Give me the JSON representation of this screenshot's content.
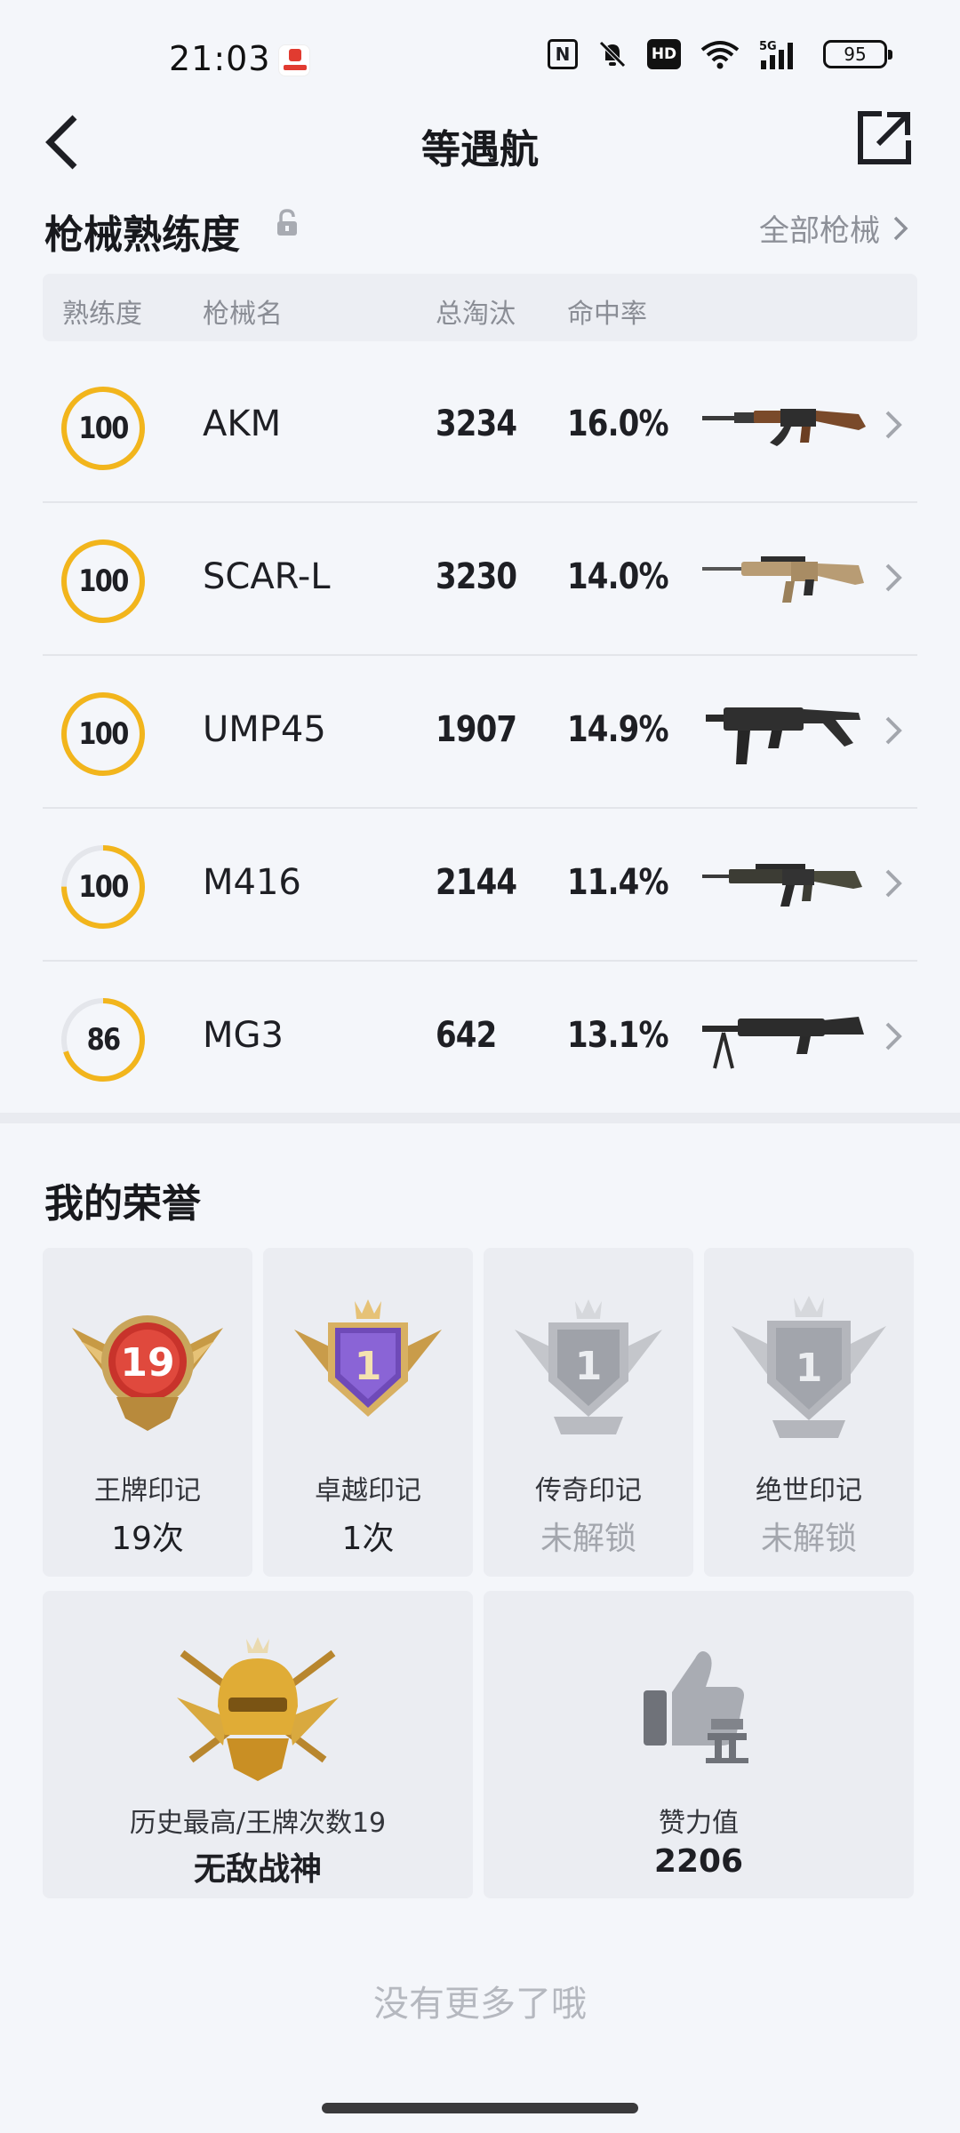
{
  "status_bar": {
    "time": "21:03",
    "icons": [
      "app-notification-icon",
      "nfc-icon",
      "mute-icon",
      "hd-icon",
      "wifi-icon",
      "5g-signal-icon"
    ],
    "nfc_text": "N",
    "hd_text": "HD",
    "net_text": "5G",
    "battery": "95"
  },
  "header": {
    "title": "等遇航",
    "back_icon": "chevron-left-icon",
    "share_icon": "share-external-icon"
  },
  "weapons": {
    "section_title": "枪械熟练度",
    "all_label": "全部枪械",
    "columns": {
      "mastery": "熟练度",
      "name": "枪械名",
      "kills": "总淘汰",
      "accuracy": "命中率"
    },
    "rows": [
      {
        "mastery": "100",
        "mastery_progress": 1.0,
        "name": "AKM",
        "kills": "3234",
        "accuracy": "16.0%"
      },
      {
        "mastery": "100",
        "mastery_progress": 1.0,
        "name": "SCAR-L",
        "kills": "3230",
        "accuracy": "14.0%"
      },
      {
        "mastery": "100",
        "mastery_progress": 1.0,
        "name": "UMP45",
        "kills": "1907",
        "accuracy": "14.9%"
      },
      {
        "mastery": "100",
        "mastery_progress": 0.75,
        "name": "M416",
        "kills": "2144",
        "accuracy": "11.4%"
      },
      {
        "mastery": "86",
        "mastery_progress": 0.7,
        "name": "MG3",
        "kills": "642",
        "accuracy": "13.1%"
      }
    ]
  },
  "honors": {
    "section_title": "我的荣誉",
    "marks": [
      {
        "badge": "19",
        "label": "王牌印记",
        "value": "19次",
        "locked": false
      },
      {
        "badge": "1",
        "label": "卓越印记",
        "value": "1次",
        "locked": false
      },
      {
        "badge": "1",
        "label": "传奇印记",
        "value": "未解锁",
        "locked": true
      },
      {
        "badge": "1",
        "label": "绝世印记",
        "value": "未解锁",
        "locked": true
      }
    ],
    "highest": {
      "label": "历史最高/王牌次数19",
      "value": "无敌战神"
    },
    "likes": {
      "label": "赞力值",
      "value": "2206"
    }
  },
  "footer": {
    "no_more": "没有更多了哦"
  },
  "colors": {
    "accent_gold": "#f2b51c",
    "ring_track": "#e4e6eb",
    "background": "#f4f6fa"
  }
}
